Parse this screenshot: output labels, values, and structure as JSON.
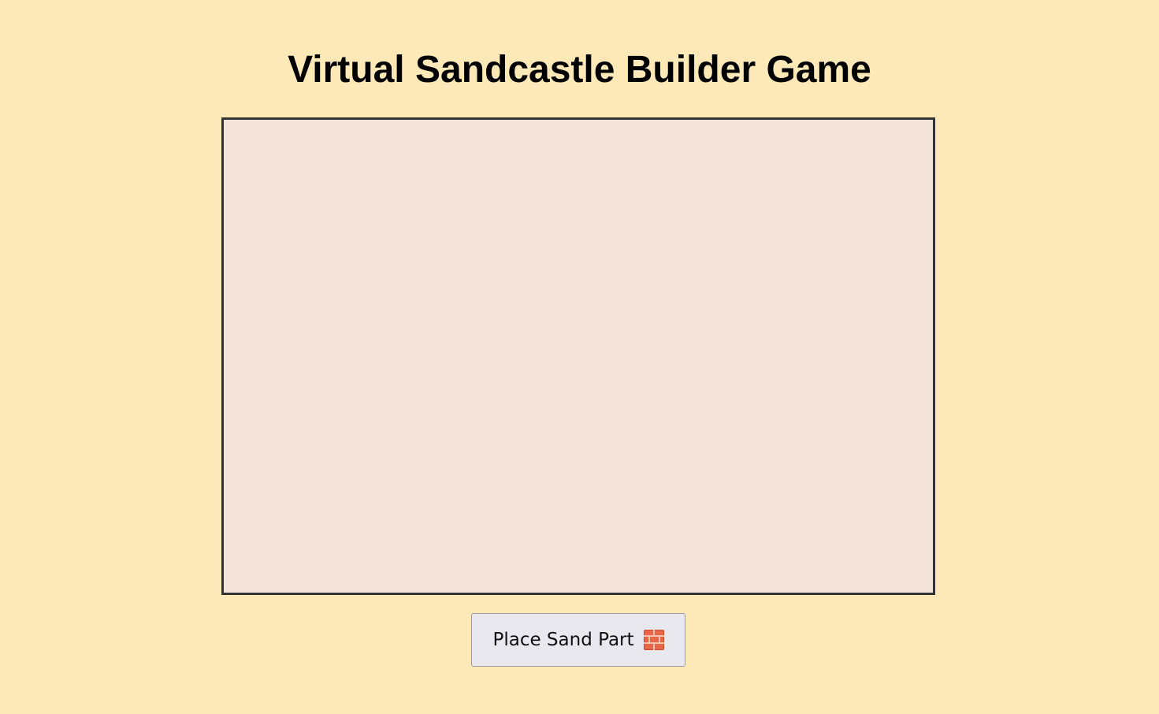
{
  "page": {
    "title": "Virtual Sandcastle Builder Game"
  },
  "board": {
    "background": "#f3e3d8",
    "border_color": "#333333"
  },
  "controls": {
    "place_button_label": "Place Sand Part",
    "place_button_icon": "brick-icon"
  },
  "colors": {
    "page_background": "#fde8b8",
    "button_background": "#e8e8ee",
    "brick": "#d9573a"
  }
}
